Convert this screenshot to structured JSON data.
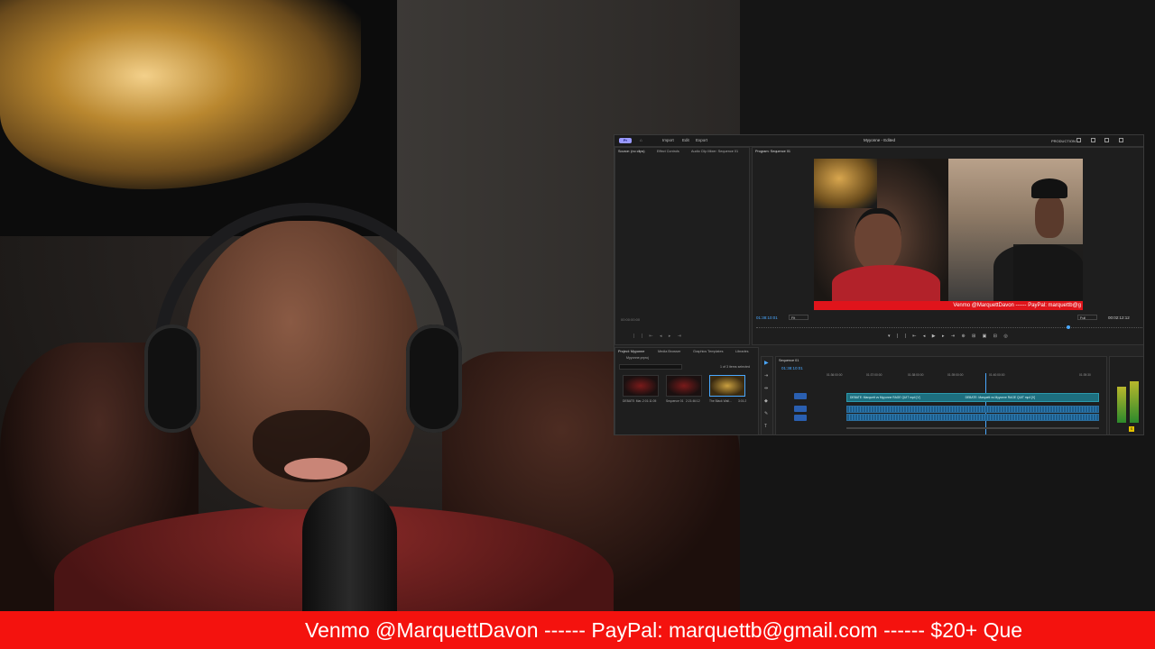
{
  "premiere": {
    "window_title": "Myyonne - Edited",
    "logo": "Pr",
    "nav": [
      "Import",
      "Edit",
      "Export"
    ],
    "workspace": "PRODUCTION",
    "source_tabs": [
      "Source: (no clips)",
      "Effect Controls",
      "Audio Clip Mixer: Sequence 01"
    ],
    "source_timecode": "00:00:00:00",
    "program_tab": "Program: Sequence 01",
    "program_timecode": "01:38:10:01",
    "program_fit": "Fit",
    "program_quality": "Full",
    "program_duration": "00:02:12:12",
    "video_ticker": "Venmo @MarquettDavon ------ PayPal: marquettb@g",
    "project_tabs": [
      "Project: Myyonne",
      "Media Browser",
      "Graphics Templates",
      "Libraries"
    ],
    "project_file": "Myyonne.prproj",
    "project_selection": "1 of 3 items selected",
    "project_items": [
      {
        "name": "DEBATE: Mar...",
        "duration": "2:01:11:05"
      },
      {
        "name": "Sequence 01",
        "duration": "2:21:46:12"
      },
      {
        "name": "The Black Wall...",
        "duration": "3:01:2"
      }
    ],
    "sequence_tab": "Sequence 01",
    "sequence_timecode": "01:38:10:01",
    "ruler": [
      "01:36:00:00",
      "01:37:00:00",
      "01:38:00:00",
      "01:39:00:00",
      "01:40:00:00",
      "01:39:30"
    ],
    "clip_label_1": "DEBATE: Marquett vs Myyonne RAGE QUIT mp4 [V]",
    "clip_label_2": "DEBATE: Marquett vs Myyonne RAGE QUIT mp4 [V]",
    "track_labels": [
      "V1",
      "A1",
      "A2"
    ]
  },
  "ticker": {
    "text": "Venmo @MarquettDavon ------ PayPal: marquettb@gmail.com ------ $20+ Que"
  },
  "colors": {
    "ticker": "#f4120e",
    "accent": "#4aa8ff",
    "clip": "#1d6f7f"
  }
}
